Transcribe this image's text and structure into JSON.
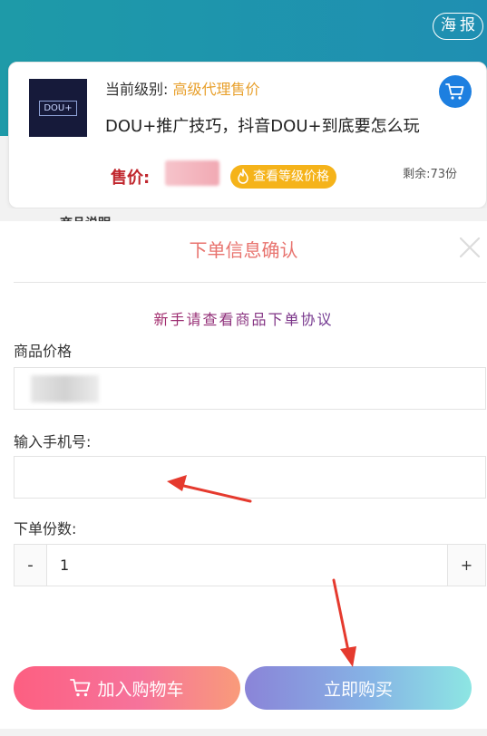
{
  "header": {
    "poster_label": "海报"
  },
  "product": {
    "thumb_text": "DOU+",
    "level_prefix": "当前级别:",
    "level_name": "高级代理售价",
    "title": "DOU+推广技巧，抖音DOU+到底要怎么玩",
    "price_label": "售价:",
    "level_badge": "查看等级价格",
    "stock": "剩余:73份",
    "peek_text": "商品说明"
  },
  "order_sheet": {
    "title": "下单信息确认",
    "agreement": "新手请查看商品下单协议",
    "price_label": "商品价格",
    "phone_label": "输入手机号:",
    "phone_value": "",
    "qty_label": "下单份数:",
    "qty_minus": "-",
    "qty_value": "1",
    "qty_plus": "+",
    "add_to_cart": "加入购物车",
    "buy_now": "立即购买"
  },
  "colors": {
    "header_teal": "#1e9aa8",
    "title_red": "#e8736e",
    "level_orange": "#e8a02c",
    "price_red": "#c0262d",
    "cart_blue": "#1d7fe0",
    "arrow_red": "#e53a2e"
  }
}
